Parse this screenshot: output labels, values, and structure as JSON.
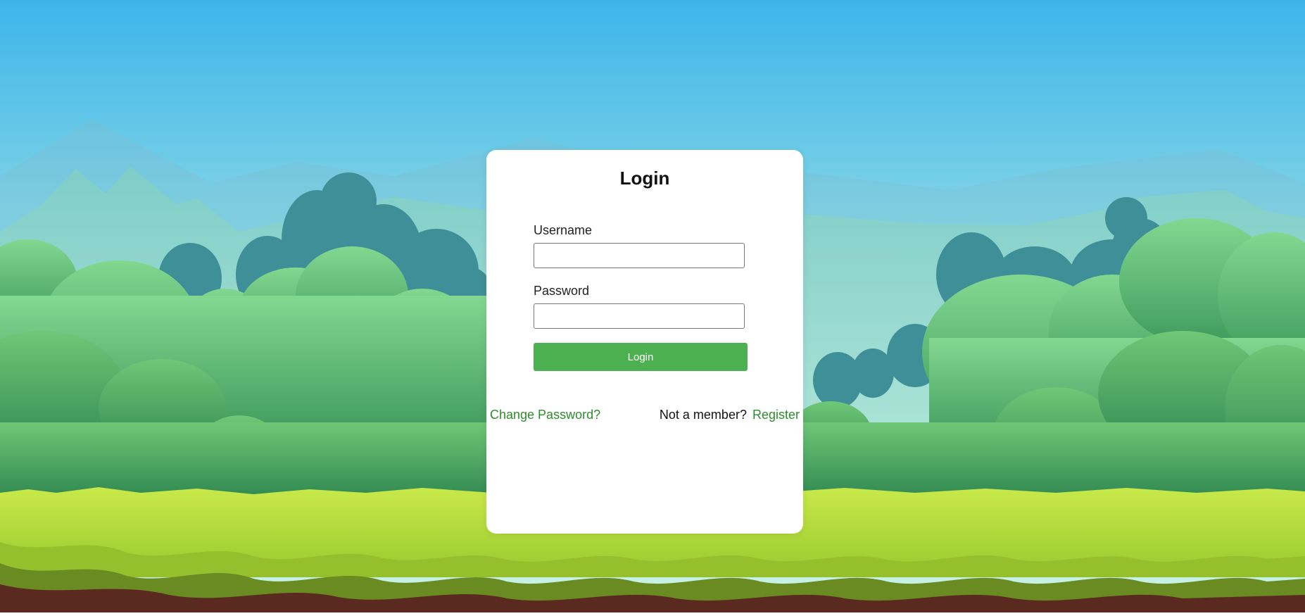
{
  "login": {
    "title": "Login",
    "username_label": "Username",
    "username_value": "",
    "password_label": "Password",
    "password_value": "",
    "button_label": "Login",
    "change_password_link": "Change Password?",
    "not_member_text": "Not a member?",
    "register_link": "Register"
  },
  "colors": {
    "button": "#4caf50",
    "link": "#2e8b2e",
    "sky_top": "#3db5ea",
    "grass": "#b5dd3a",
    "soil": "#5a2a20"
  }
}
